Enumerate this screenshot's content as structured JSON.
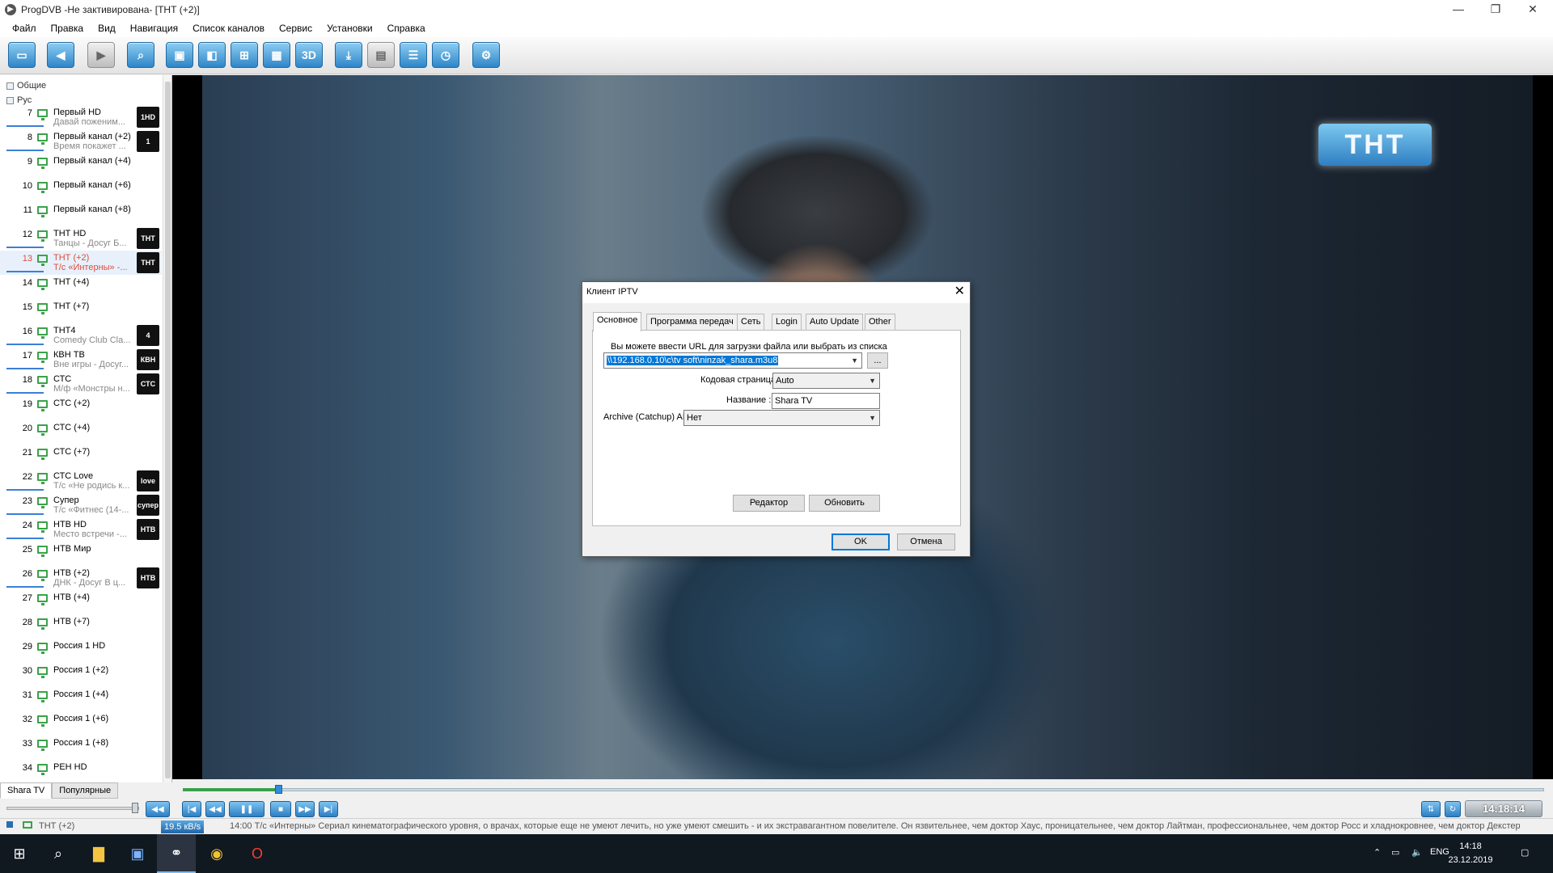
{
  "window": {
    "title": "ProgDVB -Не зактивирована-  [ТНТ (+2)]",
    "minimize": "—",
    "maximize": "❐",
    "close": "✕"
  },
  "menu": [
    "Файл",
    "Правка",
    "Вид",
    "Навигация",
    "Список каналов",
    "Сервис",
    "Установки",
    "Справка"
  ],
  "toolbar": {
    "buttons": [
      "window-icon",
      "back-icon",
      "forward-icon",
      "search-icon",
      "screen-1-icon",
      "screen-2-icon",
      "grid-4-icon",
      "grid-9-icon",
      "3d-icon",
      "record-icon",
      "teletext-icon",
      "epg-list-icon",
      "scheduler-icon",
      "settings-icon"
    ],
    "label_3d": "3D"
  },
  "sidebar": {
    "groups": [
      "Общие",
      "Рус"
    ],
    "channels": [
      {
        "num": "7",
        "name": "Первый HD",
        "prog": "Давай поженим...",
        "logo": "1HD",
        "bar": true
      },
      {
        "num": "8",
        "name": "Первый канал (+2)",
        "prog": "Время покажет ...",
        "logo": "1",
        "bar": true
      },
      {
        "num": "9",
        "name": "Первый канал (+4)",
        "prog": "",
        "logo": "",
        "bar": false
      },
      {
        "num": "10",
        "name": "Первый канал (+6)",
        "prog": "",
        "logo": "",
        "bar": false
      },
      {
        "num": "11",
        "name": "Первый канал (+8)",
        "prog": "",
        "logo": "",
        "bar": false
      },
      {
        "num": "12",
        "name": "ТНТ HD",
        "prog": "Танцы - Досуг Б...",
        "logo": "ТНТ",
        "bar": true
      },
      {
        "num": "13",
        "name": "ТНТ (+2)",
        "prog": "Т/с «Интерны» -...",
        "logo": "ТНТ",
        "bar": true,
        "selected": true
      },
      {
        "num": "14",
        "name": "ТНТ (+4)",
        "prog": "",
        "logo": "",
        "bar": false
      },
      {
        "num": "15",
        "name": "ТНТ (+7)",
        "prog": "",
        "logo": "",
        "bar": false
      },
      {
        "num": "16",
        "name": "ТНТ4",
        "prog": "Comedy Club Cla...",
        "logo": "4",
        "bar": true
      },
      {
        "num": "17",
        "name": "КВН ТВ",
        "prog": "Вне игры - Досуг...",
        "logo": "КВН",
        "bar": true
      },
      {
        "num": "18",
        "name": "СТС",
        "prog": "М/ф «Монстры н...",
        "logo": "СТС",
        "bar": true
      },
      {
        "num": "19",
        "name": "СТС (+2)",
        "prog": "",
        "logo": "",
        "bar": false
      },
      {
        "num": "20",
        "name": "СТС (+4)",
        "prog": "",
        "logo": "",
        "bar": false
      },
      {
        "num": "21",
        "name": "СТС (+7)",
        "prog": "",
        "logo": "",
        "bar": false
      },
      {
        "num": "22",
        "name": "СТС Love",
        "prog": "Т/с «Не родись к...",
        "logo": "love",
        "bar": true
      },
      {
        "num": "23",
        "name": "Супер",
        "prog": "Т/с «Фитнес (14-...",
        "logo": "супер",
        "bar": true
      },
      {
        "num": "24",
        "name": "НТВ HD",
        "prog": "Место встречи -...",
        "logo": "НТВ",
        "bar": true
      },
      {
        "num": "25",
        "name": "НТВ Мир",
        "prog": "",
        "logo": "",
        "bar": false
      },
      {
        "num": "26",
        "name": "НТВ (+2)",
        "prog": "ДНК - Досуг В ц...",
        "logo": "НТВ",
        "bar": true
      },
      {
        "num": "27",
        "name": "НТВ (+4)",
        "prog": "",
        "logo": "",
        "bar": false
      },
      {
        "num": "28",
        "name": "НТВ (+7)",
        "prog": "",
        "logo": "",
        "bar": false
      },
      {
        "num": "29",
        "name": "Россия 1 HD",
        "prog": "",
        "logo": "",
        "bar": false
      },
      {
        "num": "30",
        "name": "Россия 1 (+2)",
        "prog": "",
        "logo": "",
        "bar": false
      },
      {
        "num": "31",
        "name": "Россия 1 (+4)",
        "prog": "",
        "logo": "",
        "bar": false
      },
      {
        "num": "32",
        "name": "Россия 1 (+6)",
        "prog": "",
        "logo": "",
        "bar": false
      },
      {
        "num": "33",
        "name": "Россия 1 (+8)",
        "prog": "",
        "logo": "",
        "bar": false
      },
      {
        "num": "34",
        "name": "РЕН HD",
        "prog": "",
        "logo": "",
        "bar": false
      }
    ],
    "tabs": [
      "Shara TV",
      "Популярные"
    ]
  },
  "video": {
    "logo_text": "ТНТ"
  },
  "dialog": {
    "title": "Клиент IPTV",
    "tabs": [
      "Основное",
      "Программа передач",
      "Сеть",
      "Login",
      "Auto Update",
      "Other"
    ],
    "url_hint": "Вы можете ввести URL для загрузки файла или выбрать из списка",
    "url_value": "\\\\192.168.0.10\\c\\tv soft\\ninzak_shara.m3u8",
    "browse": "...",
    "codepage_label": "Кодовая страница :",
    "codepage_value": "Auto",
    "name_label": "Название :",
    "name_value": "Shara TV",
    "archive_label": "Archive (Catchup) API :",
    "archive_value": "Нет",
    "editor_btn": "Редактор",
    "refresh_btn": "Обновить",
    "ok_btn": "OK",
    "cancel_btn": "Отмена"
  },
  "player": {
    "progress_fraction": 0.07,
    "time": "14:18:14"
  },
  "status": {
    "channel": "ТНТ (+2)",
    "rate": "19.5 кВ/s",
    "epg": "14:00 Т/с «Интерны» Сериал кинематографического уровня, о врачах, которые еще не умеют лечить, но уже умеют смешить - и их экстравагантном повелителе. Он язвительнее, чем доктор Хаус, проницательнее, чем доктор Лайтман, профессиональнее, чем доктор Росс и хладнокровнее, чем доктор Декстер"
  },
  "taskbar": {
    "lang": "ENG",
    "time": "14:18",
    "date": "23.12.2019"
  },
  "colors": {
    "accent": "#2e86c8",
    "selected_channel": "#e04b3c",
    "channel_icon": "#3aa24a",
    "taskbar": "#101820"
  }
}
